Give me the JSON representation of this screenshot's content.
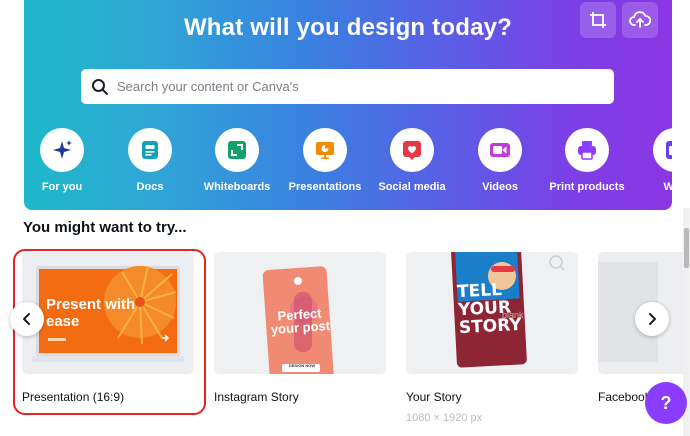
{
  "hero": {
    "title": "What will you design today?",
    "search_placeholder": "Search your content or Canva's",
    "gradient_colors": [
      "#1fb8c9",
      "#3b7fe0",
      "#7d3fe6",
      "#8b36e4"
    ]
  },
  "categories": [
    {
      "label": "For you",
      "icon": "sparkle-icon",
      "color": "#1a3a8f",
      "active": true
    },
    {
      "label": "Docs",
      "icon": "doc-icon",
      "color": "#13a3b5"
    },
    {
      "label": "Whiteboards",
      "icon": "whiteboard-icon",
      "color": "#14a06b"
    },
    {
      "label": "Presentations",
      "icon": "presentation-icon",
      "color": "#f28b00"
    },
    {
      "label": "Social media",
      "icon": "heart-icon",
      "color": "#e63946"
    },
    {
      "label": "Videos",
      "icon": "video-icon",
      "color": "#c13bd9"
    },
    {
      "label": "Print products",
      "icon": "printer-icon",
      "color": "#8b3dff"
    },
    {
      "label": "Web",
      "icon": "web-icon",
      "color": "#6a3df0"
    }
  ],
  "section": {
    "title": "You might want to try..."
  },
  "cards": [
    {
      "name": "Presentation (16:9)",
      "thumb_text": "Present with ease"
    },
    {
      "name": "Instagram Story",
      "thumb_text": "Perfect your post",
      "thumb_badge": "DESIGN NOW"
    },
    {
      "name": "Your Story",
      "sub": "1080 × 1920 px",
      "thumb_text": "TELL YOUR STORY",
      "thumb_badge": "blank"
    },
    {
      "name": "Facebook"
    }
  ],
  "help": {
    "label": "?"
  },
  "colors": {
    "accent": "#8b3dff",
    "highlight": "#e5231f",
    "text": "#0e1318"
  }
}
